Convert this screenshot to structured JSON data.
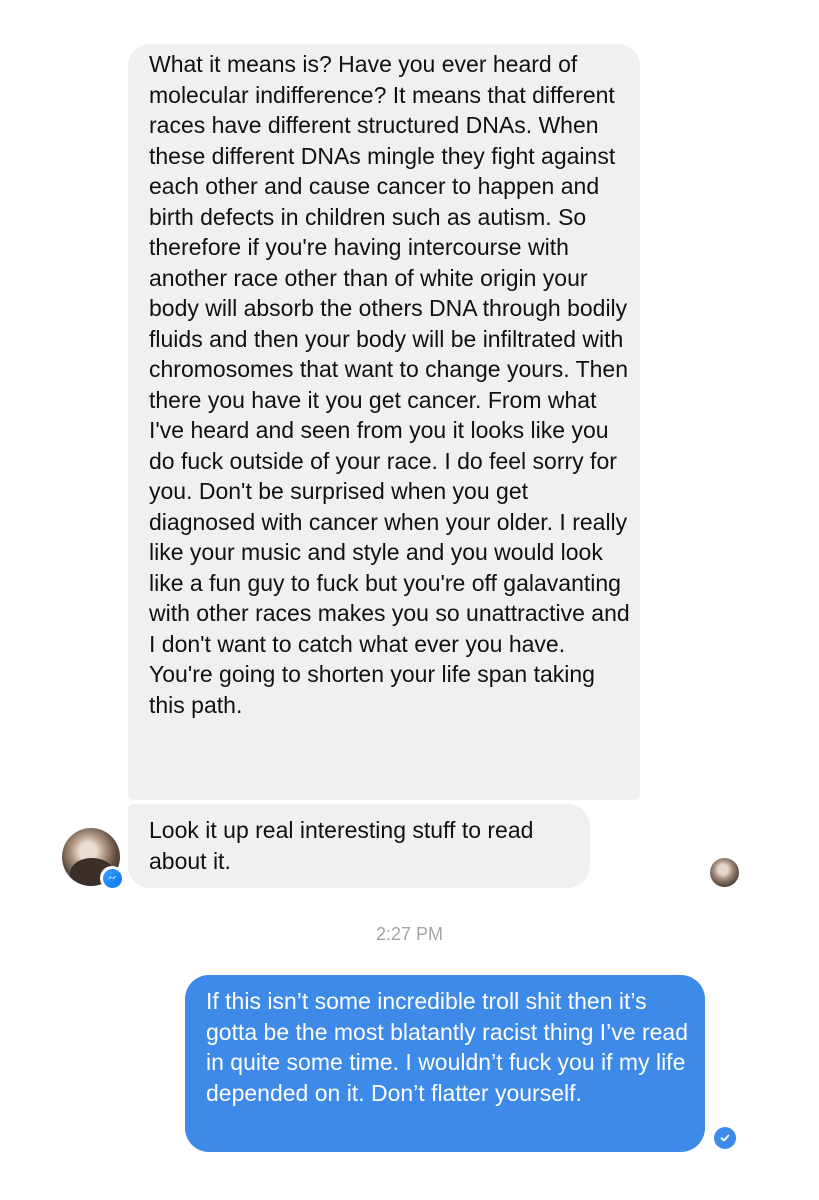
{
  "conversation": {
    "messages": [
      {
        "sender": "other",
        "text": "What it means is? Have you ever heard of molecular indifference? It means that different races have different structured DNAs. When these different DNAs mingle they fight against each other and cause cancer to happen and birth defects in children such as autism. So therefore if you're having intercourse with another race other than of white origin your body will absorb the others DNA through bodily fluids and then your body will be infiltrated with chromosomes that want to change yours. Then there you have it you get cancer. From what I've heard and seen from you it looks like you do fuck outside of your race. I do feel sorry for you. Don't be surprised when you get diagnosed with cancer when your older. I really like your music and style and you would look like a fun guy to fuck but you're off galavanting with other races makes you so unattractive and I don't want to catch what ever you have. You're going to shorten your life span taking this path."
      },
      {
        "sender": "other",
        "text": "Look it up real interesting stuff to read about it."
      },
      {
        "sender": "me",
        "text": "If this isn’t some incredible troll shit then it’s gotta be the most blatantly racist thing I’ve read in quite some time. I wouldn’t fuck you if my life depended on it. Don’t flatter yourself."
      }
    ],
    "timestamp": "2:27 PM"
  },
  "icons": {
    "avatar": "profile-photo",
    "badge": "messenger-icon",
    "seen": "seen-avatar-icon",
    "delivered": "delivered-check-icon"
  },
  "colors": {
    "incoming_bubble": "#f1f0f0",
    "outgoing_bubble": "#3d8ae8",
    "timestamp": "#a4a4a4"
  }
}
